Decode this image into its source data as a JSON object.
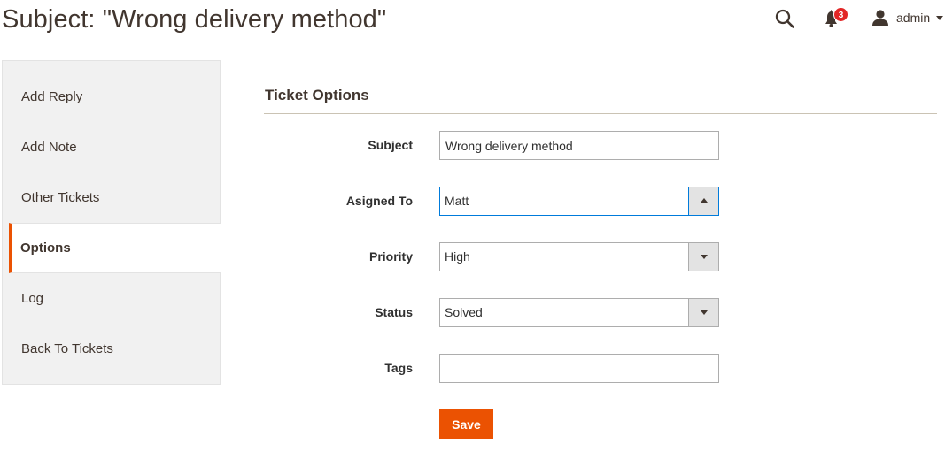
{
  "page": {
    "title": "Subject: \"Wrong delivery method\""
  },
  "header": {
    "search_icon": "search-icon",
    "notifications": {
      "icon": "bell-icon",
      "count": "3",
      "badge_color": "#e22626"
    },
    "user": {
      "icon": "user-icon",
      "name": "admin"
    }
  },
  "sidebar": {
    "items": [
      {
        "label": "Add Reply",
        "active": false
      },
      {
        "label": "Add Note",
        "active": false
      },
      {
        "label": "Other Tickets",
        "active": false
      },
      {
        "label": "Options",
        "active": true
      },
      {
        "label": "Log",
        "active": false
      },
      {
        "label": "Back To Tickets",
        "active": false
      }
    ]
  },
  "form": {
    "section_title": "Ticket Options",
    "subject": {
      "label": "Subject",
      "value": "Wrong delivery method"
    },
    "assigned_to": {
      "label": "Asigned To",
      "value": "Matt",
      "open": true
    },
    "priority": {
      "label": "Priority",
      "value": "High"
    },
    "status": {
      "label": "Status",
      "value": "Solved"
    },
    "tags": {
      "label": "Tags",
      "value": ""
    },
    "save_label": "Save"
  },
  "colors": {
    "accent": "#eb5202",
    "focus": "#007bdb",
    "sidebar_bg": "#f1f1f1"
  }
}
